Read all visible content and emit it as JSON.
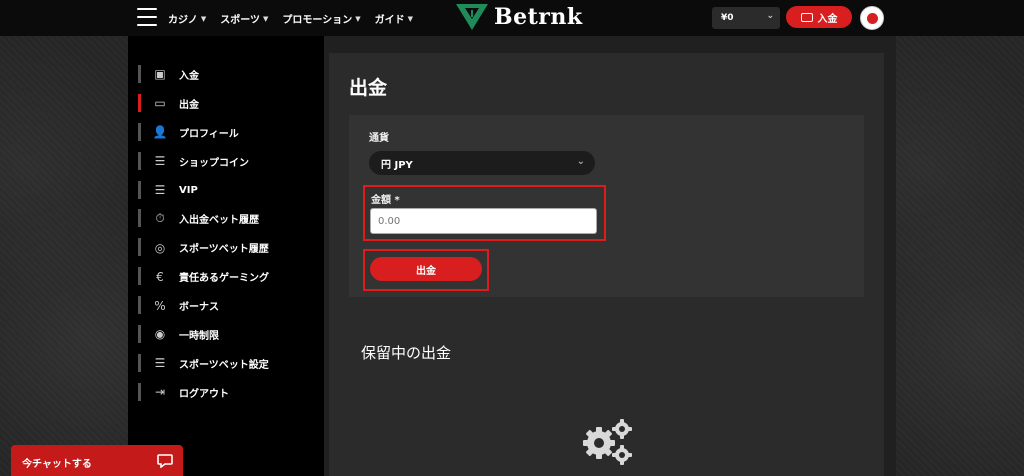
{
  "header": {
    "nav": [
      {
        "label": "カジノ"
      },
      {
        "label": "スポーツ"
      },
      {
        "label": "プロモーション"
      },
      {
        "label": "ガイド"
      }
    ],
    "logo_text": "Betrnk",
    "balance": "¥0",
    "deposit_label": "入金"
  },
  "sidebar": {
    "items": [
      {
        "label": "入金",
        "icon": "cash-icon"
      },
      {
        "label": "出金",
        "icon": "atm-icon"
      },
      {
        "label": "プロフィール",
        "icon": "user-icon"
      },
      {
        "label": "ショップコイン",
        "icon": "sliders-icon"
      },
      {
        "label": "VIP",
        "icon": "sliders-icon"
      },
      {
        "label": "入出金ベット履歴",
        "icon": "history-icon"
      },
      {
        "label": "スポーツベット履歴",
        "icon": "ball-icon"
      },
      {
        "label": "責任あるゲーミング",
        "icon": "euro-icon"
      },
      {
        "label": "ボーナス",
        "icon": "percent-icon"
      },
      {
        "label": "一時制限",
        "icon": "eye-icon"
      },
      {
        "label": "スポーツベット設定",
        "icon": "sliders-icon"
      },
      {
        "label": "ログアウト",
        "icon": "logout-icon"
      }
    ],
    "active_index": 1
  },
  "main": {
    "title": "出金",
    "currency_label": "通貨",
    "currency_value": "円 JPY",
    "amount_label": "金額 *",
    "amount_placeholder": "0.00",
    "submit_label": "出金",
    "pending_title": "保留中の出金"
  },
  "chat": {
    "label": "今チャットする"
  },
  "colors": {
    "accent": "#d81e1e",
    "highlight_border": "#e01b1b",
    "logo_green": "#1f8a5a"
  }
}
